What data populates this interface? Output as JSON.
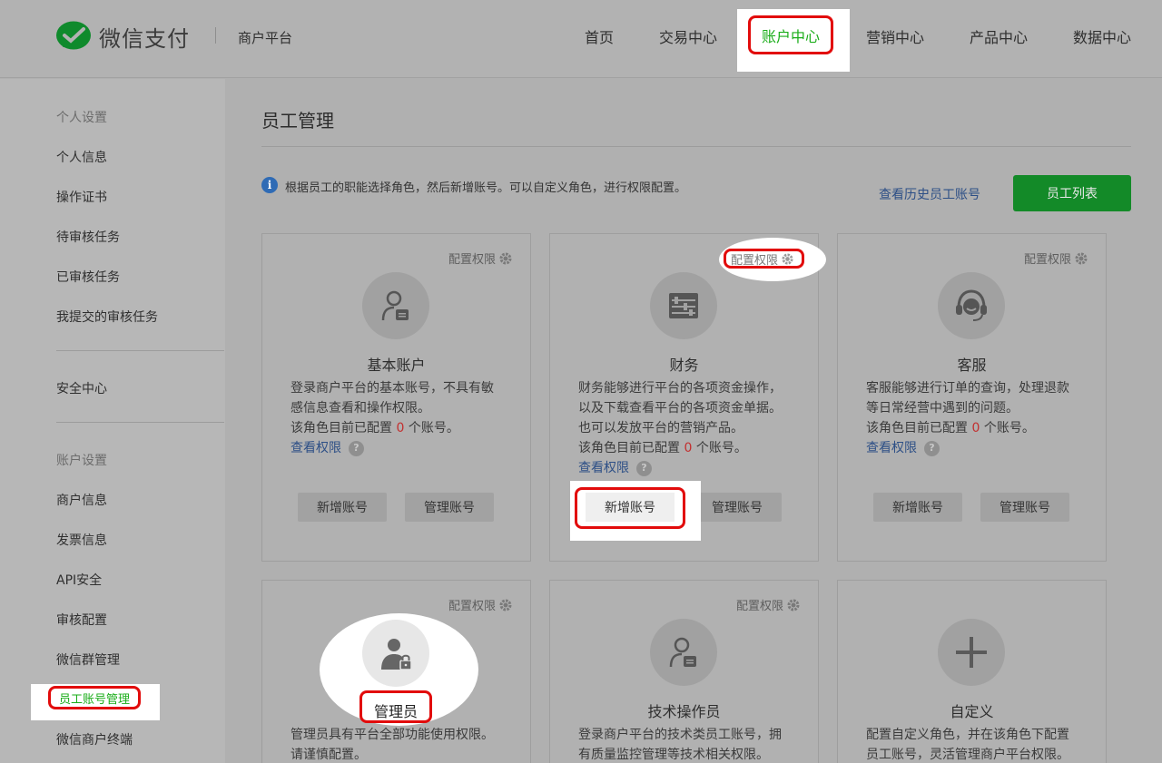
{
  "header": {
    "brand": "微信支付",
    "sub": "商户平台",
    "nav": [
      "首页",
      "交易中心",
      "账户中心",
      "营销中心",
      "产品中心",
      "数据中心"
    ],
    "active_nav": "账户中心"
  },
  "sidebar": {
    "group1": "个人设置",
    "items1": [
      "个人信息",
      "操作证书",
      "待审核任务",
      "已审核任务",
      "我提交的审核任务"
    ],
    "security": "安全中心",
    "group2": "账户设置",
    "items2": [
      "商户信息",
      "发票信息",
      "API安全",
      "审核配置",
      "微信群管理"
    ],
    "active": "员工账号管理",
    "last": "微信商户终端"
  },
  "main": {
    "title": "员工管理",
    "info_icon": "i",
    "info": "根据员工的职能选择角色，然后新增账号。可以自定义角色，进行权限配置。",
    "history_link": "查看历史员工账号",
    "list_button": "员工列表",
    "config_label": "配置权限",
    "view_perm": "查看权限",
    "help": "?",
    "add_btn": "新增账号",
    "manage_btn": "管理账号",
    "count_prefix": "该角色目前已配置",
    "count_suffix": "个账号。",
    "cards": [
      {
        "name": "基本账户",
        "desc1": "登录商户平台的基本账号，不具有敏",
        "desc2": "感信息查看和操作权限。",
        "count": "0",
        "icon": "user-doc-icon"
      },
      {
        "name": "财务",
        "desc1": "财务能够进行平台的各项资金操作，",
        "desc2": "以及下载查看平台的各项资金单据。",
        "desc3": "也可以发放平台的营销产品。",
        "count": "0",
        "icon": "abacus-icon"
      },
      {
        "name": "客服",
        "desc1": "客服能够进行订单的查询，处理退款",
        "desc2": "等日常经营中遇到的问题。",
        "count": "0",
        "icon": "headset-icon"
      },
      {
        "name": "管理员",
        "desc1": "管理员具有平台全部功能使用权限。",
        "desc2": "请谨慎配置。",
        "icon": "admin-lock-icon"
      },
      {
        "name": "技术操作员",
        "desc1": "登录商户平台的技术类员工账号，拥",
        "desc2": "有质量监控管理等技术相关权限。",
        "icon": "user-doc-icon"
      },
      {
        "name": "自定义",
        "desc1": "配置自定义角色，并在该角色下配置",
        "desc2": "员工账号，灵活管理商户平台权限。",
        "icon": "plus-icon"
      }
    ]
  }
}
